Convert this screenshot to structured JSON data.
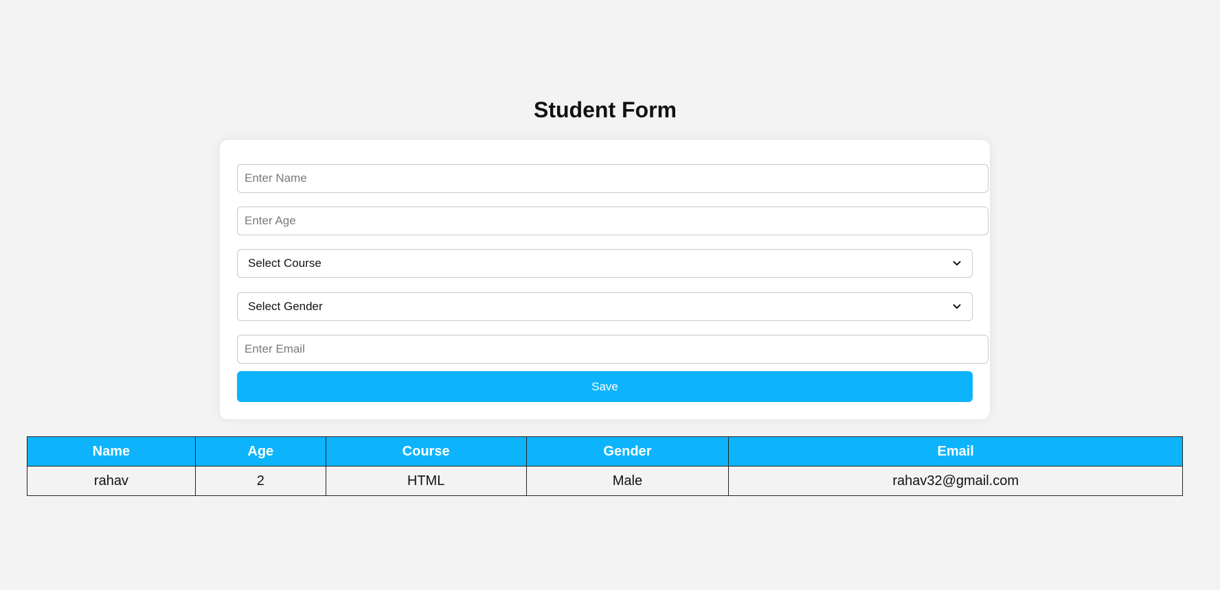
{
  "page": {
    "title": "Student Form"
  },
  "form": {
    "name_field": {
      "placeholder": "Enter Name",
      "value": ""
    },
    "age_field": {
      "placeholder": "Enter Age",
      "value": ""
    },
    "course_select": {
      "selected": "Select Course"
    },
    "gender_select": {
      "selected": "Select Gender"
    },
    "email_field": {
      "placeholder": "Enter Email",
      "value": ""
    },
    "save_label": "Save"
  },
  "table": {
    "headers": [
      "Name",
      "Age",
      "Course",
      "Gender",
      "Email"
    ],
    "rows": [
      [
        "rahav",
        "2",
        "HTML",
        "Male",
        "rahav32@gmail.com"
      ]
    ]
  },
  "colors": {
    "accent": "#0db4fb",
    "background": "#f3f3f3",
    "card": "#ffffff"
  },
  "icons": {
    "select_arrow": "chevron-down-icon"
  }
}
